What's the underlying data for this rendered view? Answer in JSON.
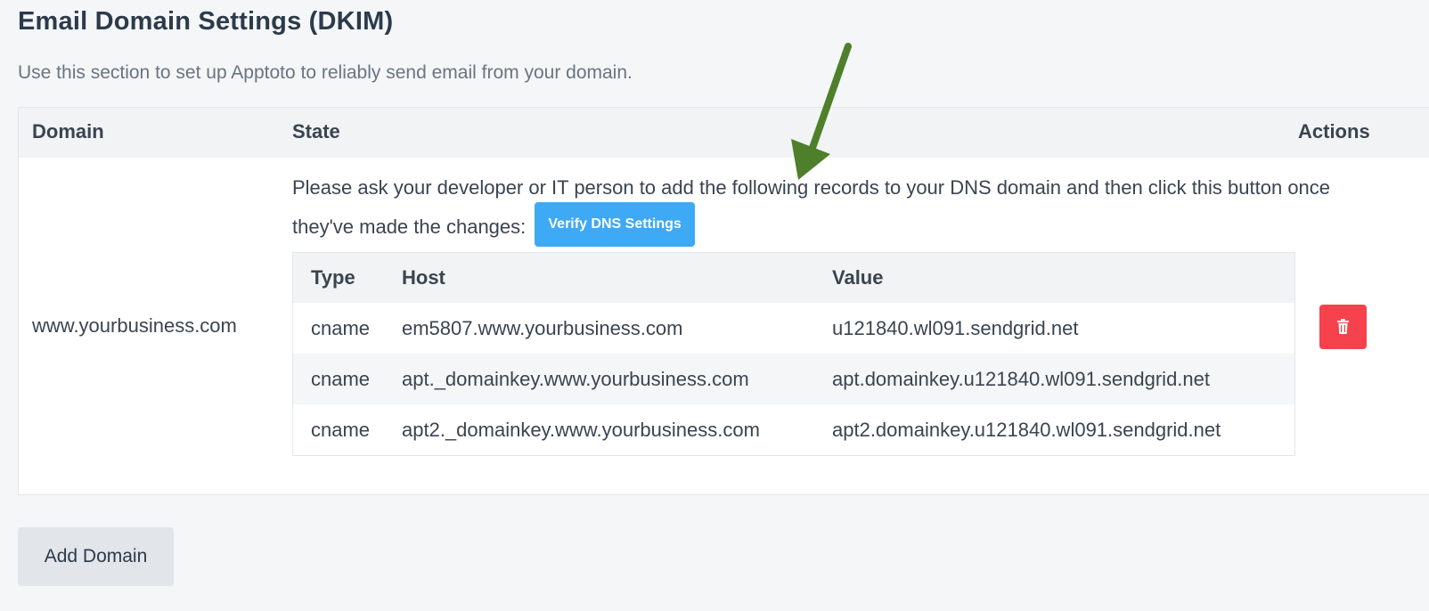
{
  "page": {
    "title": "Email Domain Settings (DKIM)",
    "subtitle": "Use this section to set up Apptoto to reliably send email from your domain."
  },
  "table": {
    "headers": {
      "domain": "Domain",
      "state": "State",
      "actions": "Actions"
    },
    "row": {
      "domain": "www.yourbusiness.com",
      "instructions": "Please ask your developer or IT person to add the following records to your DNS domain and then click this button once they've made the changes:",
      "verify_label": "Verify DNS Settings"
    }
  },
  "records": {
    "headers": {
      "type": "Type",
      "host": "Host",
      "value": "Value"
    },
    "rows": [
      {
        "type": "cname",
        "host": "em5807.www.yourbusiness.com",
        "value": "u121840.wl091.sendgrid.net"
      },
      {
        "type": "cname",
        "host": "apt._domainkey.www.yourbusiness.com",
        "value": "apt.domainkey.u121840.wl091.sendgrid.net"
      },
      {
        "type": "cname",
        "host": "apt2._domainkey.www.yourbusiness.com",
        "value": "apt2.domainkey.u121840.wl091.sendgrid.net"
      }
    ]
  },
  "footer": {
    "add_domain_label": "Add Domain"
  },
  "icons": {
    "delete": "trash-icon",
    "annotation": "arrow-down-icon"
  },
  "colors": {
    "verify_button": "#3ea9f5",
    "delete_button": "#f5424c",
    "annotation_arrow": "#4f7f2a"
  }
}
